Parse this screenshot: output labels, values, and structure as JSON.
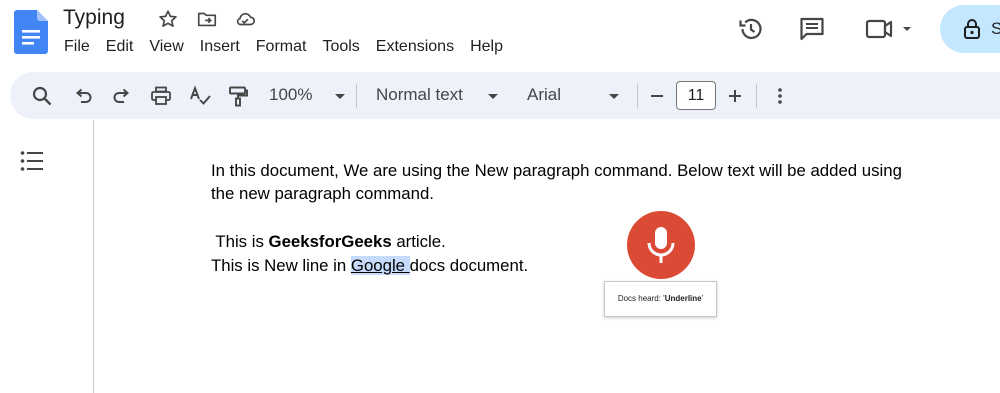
{
  "app": {
    "doc_title": "Typing",
    "menus": [
      "File",
      "Edit",
      "View",
      "Insert",
      "Format",
      "Tools",
      "Extensions",
      "Help"
    ]
  },
  "icons": {
    "star": "star-icon",
    "move": "folder-move-icon",
    "cloud": "cloud-saved-icon",
    "history": "version-history-icon",
    "comments": "comments-icon",
    "meet": "meet-video-icon",
    "share": "lock-icon"
  },
  "toolbar": {
    "zoom": "100%",
    "style": "Normal text",
    "font": "Arial",
    "font_size": "11"
  },
  "document": {
    "para1_line1": "In this document, We are using the New paragraph command. Below text will be added using",
    "para1_line2": "the new paragraph command.",
    "line3_prefix": " This is ",
    "line3_bold": "GeeksforGeeks",
    "line3_suffix": " article.",
    "line4_prefix": "This is New line in ",
    "line4_highlight": "Google ",
    "line4_suffix": "docs document."
  },
  "voice_typing": {
    "label_prefix": "Docs heard: '",
    "heard": "Underline",
    "label_suffix": "'"
  },
  "share_button": {
    "visible_letter": "S"
  },
  "colors": {
    "accent": "#1a73e8",
    "toolbar_bg": "#edf2fa",
    "share_bg": "#c2e7ff",
    "mic": "#db4a35",
    "highlight": "#c6dafc"
  }
}
